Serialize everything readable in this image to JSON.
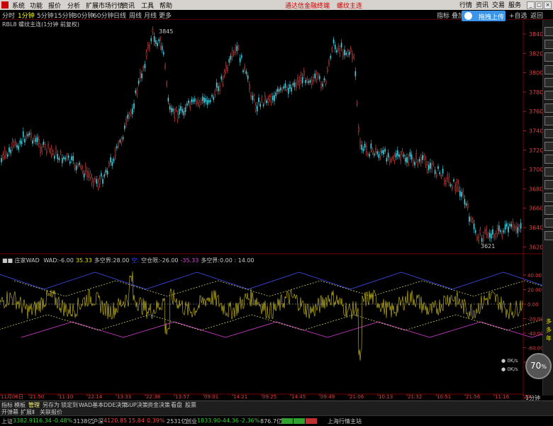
{
  "menubar": {
    "items": [
      "系统",
      "功能",
      "报价",
      "分析",
      "扩展市场行情",
      "资讯",
      "工具",
      "帮助"
    ],
    "promo": [
      "通达信金融终端",
      "螺纹主连"
    ],
    "right_items": [
      "行情",
      "资讯",
      "交易",
      "服务"
    ]
  },
  "periods": {
    "items": [
      "分时",
      "1分钟",
      "5分钟",
      "15分钟",
      "30分钟",
      "60分钟",
      "日线",
      "周线",
      "月线",
      "更多"
    ],
    "active_index": 1,
    "right_items": [
      "指标",
      "叠加",
      "+自选",
      "返回"
    ]
  },
  "upload_button": {
    "label": "拖拽上传"
  },
  "chart_title": "RBL8 螺纹主连(1分钟 前复权)",
  "price_panel": {
    "y_ticks": [
      "3840",
      "3820",
      "3800",
      "3780",
      "3760",
      "3740",
      "3720",
      "3700",
      "3680",
      "3660",
      "3640",
      "3620"
    ],
    "high_label": "3845",
    "low_label": "3621"
  },
  "indicator_panel": {
    "name": "■■ 庄家WAD",
    "values": [
      {
        "label": "WAD:",
        "value": "-6.00",
        "color": "#c8c8c8"
      },
      {
        "label": "",
        "value": "35.33",
        "color": "#e0e000"
      },
      {
        "label": "多空界:",
        "value": "28.00",
        "color": "#c8c8c8"
      },
      {
        "label": "",
        "value": "空:",
        "color": "#4040ff"
      },
      {
        "label": "空仓限:",
        "value": "-26.00",
        "color": "#c8c8c8"
      },
      {
        "label": "",
        "value": "-35.33",
        "color": "#e040e0"
      },
      {
        "label": "多空界:",
        "value": "0.00 : 14.00",
        "color": "#c8c8c8"
      }
    ],
    "y_ticks": [
      "40.00",
      "20.00",
      "0.00",
      "-20.00",
      "-40.00",
      "-60.00",
      "-80.00"
    ]
  },
  "time_axis": [
    "11月06日",
    "21:50",
    "11:10",
    "22:14",
    "13:33",
    "22:38",
    "13:57",
    "09:01",
    "14:21",
    "09:25",
    "14:45",
    "09:49",
    "21:06",
    "10:13",
    "21:32",
    "10:51",
    "21:56",
    "11:16",
    "22:"
  ],
  "right_panel_label": "1分钟",
  "right_toolbar": {
    "side_text": [
      "多",
      "多",
      "年"
    ]
  },
  "tabs": {
    "items": [
      "指标",
      "模板",
      "管理",
      "另存为",
      "锁定到",
      "WAD基本",
      "DDE决策",
      "SUP决策",
      "资金决策",
      "看盘",
      "股票"
    ],
    "active_index": 2,
    "row2": [
      "开弹幕",
      "扩展Ⅱ",
      "关联报价"
    ]
  },
  "status": {
    "items": [
      {
        "name": "上证",
        "value": "3382.91",
        "chg": "-16.34",
        "pct": "-0.48%",
        "amt": "3138亿",
        "dir": "dn"
      },
      {
        "name": "沪深",
        "value": "4120.85",
        "chg": "15.84",
        "pct": "0.39%",
        "amt": "2531亿",
        "dir": "up"
      },
      {
        "name": "创业",
        "value": "1833.90",
        "chg": "-44.36",
        "pct": "-2.36%",
        "amt": "876.7亿",
        "dir": "dn"
      }
    ],
    "source": "上海行情主站"
  },
  "gauge": {
    "value": "70",
    "unit": "%"
  },
  "net": {
    "up": "0K/s",
    "down": "0K/s"
  }
}
